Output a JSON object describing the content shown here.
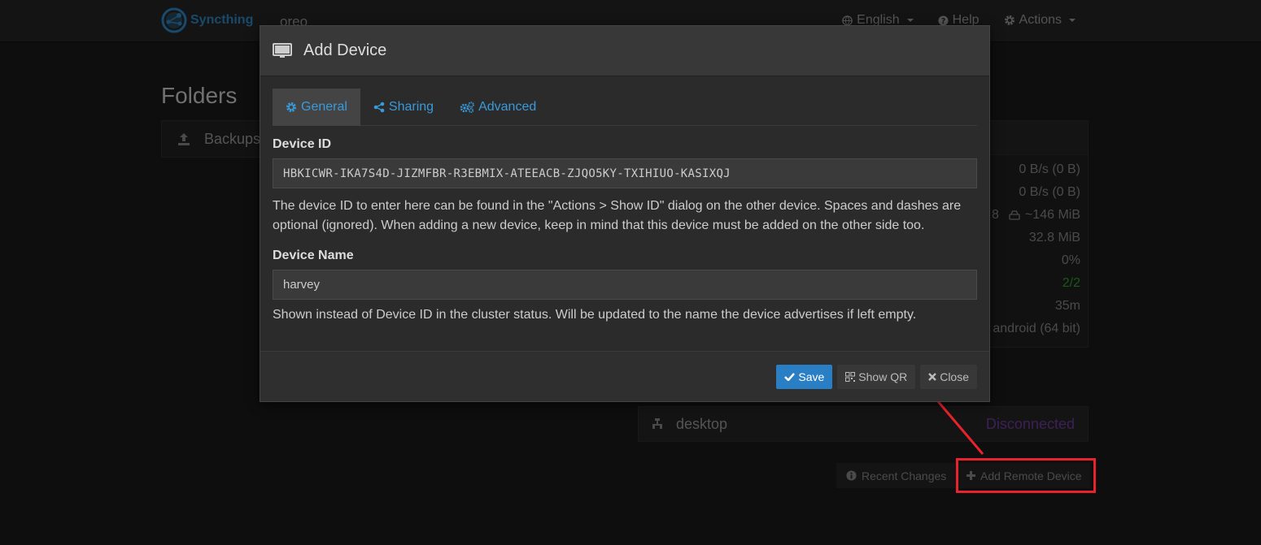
{
  "navbar": {
    "brand": "Syncthing",
    "host": "oreo",
    "language": "English",
    "help": "Help",
    "actions": "Actions"
  },
  "background": {
    "folders_heading": "Folders",
    "folder_name": "Backups",
    "stats": [
      "0 B/s (0 B)",
      "0 B/s (0 B)",
      "~146 MiB",
      "32.8 MiB",
      "0%",
      "2/2",
      "35m",
      "android (64 bit)"
    ],
    "stats_partial_prefix": "8",
    "device_name": "desktop",
    "device_status": "Disconnected",
    "recent_changes": "Recent Changes",
    "add_remote_device": "Add Remote Device"
  },
  "modal": {
    "title": "Add Device",
    "tabs": [
      {
        "label": "General",
        "icon": "gear-icon"
      },
      {
        "label": "Sharing",
        "icon": "share-icon"
      },
      {
        "label": "Advanced",
        "icon": "cogs-icon"
      }
    ],
    "device_id_label": "Device ID",
    "device_id_value": "HBKICWR-IKA7S4D-JIZMFBR-R3EBMIX-ATEEACB-ZJQO5KY-TXIHIUO-KASIXQJ",
    "device_id_help": "The device ID to enter here can be found in the \"Actions > Show ID\" dialog on the other device. Spaces and dashes are optional (ignored). When adding a new device, keep in mind that this device must be added on the other side too.",
    "device_name_label": "Device Name",
    "device_name_value": "harvey",
    "device_name_help": "Shown instead of Device ID in the cluster status. Will be updated to the name the device advertises if left empty.",
    "save": "Save",
    "show_qr": "Show QR",
    "close": "Close"
  },
  "colors": {
    "accent": "#2a7fc4",
    "link": "#3a9ad9",
    "disconnected": "#6e3d9c",
    "up_to_date": "#2ca02c",
    "annotation": "#e8232b"
  }
}
